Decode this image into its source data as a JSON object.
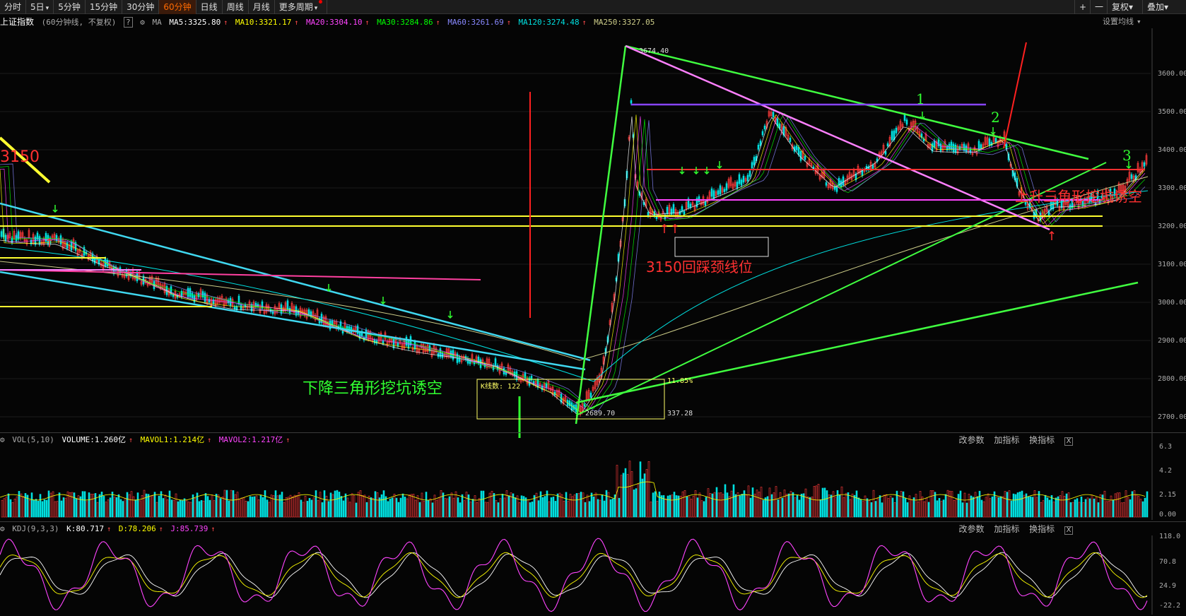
{
  "toolbar": {
    "tabs": [
      "分时",
      "5日",
      "5分钟",
      "15分钟",
      "30分钟",
      "60分钟",
      "日线",
      "周线",
      "月线",
      "更多周期"
    ],
    "active": "60分钟",
    "right": {
      "plus": "+",
      "minus": "一",
      "fuquan": "复权",
      "diejia": "叠加"
    }
  },
  "main_legend": {
    "title": "上证指数",
    "subtitle": "(60分钟线, 不复权)",
    "help": "?",
    "ma_label": "MA",
    "ma5": "MA5:3325.80",
    "ma10": "MA10:3321.17",
    "ma20": "MA20:3304.10",
    "ma30": "MA30:3284.86",
    "ma60": "MA60:3261.69",
    "ma120": "MA120:3274.48",
    "ma250": "MA250:3327.05",
    "settings": "设置均线"
  },
  "price_axis": [
    "3600.00",
    "3500.00",
    "3400.00",
    "3300.00",
    "3200.00",
    "3100.00",
    "3000.00",
    "2900.00",
    "2800.00",
    "2700.00"
  ],
  "annotations": {
    "left_3150": "3150",
    "desc_triangle": "下降三角形挖坑诱空",
    "asc_triangle": "上升三角形挖坑诱空",
    "neckline": "3150回踩颈线位",
    "high_label": "3674.40",
    "low_label": "2689.70",
    "kline_count": "K线数: 122",
    "pct": "11.85%",
    "span": "337.28",
    "num1": "1",
    "num2": "2",
    "num3": "3"
  },
  "vol_legend": {
    "name": "VOL(5,10)",
    "volume": "VOLUME:1.260亿",
    "mavol1": "MAVOL1:1.214亿",
    "mavol2": "MAVOL2:1.217亿"
  },
  "vol_axis": [
    "6.3",
    "4.2",
    "2.15",
    "0.00"
  ],
  "kdj_legend": {
    "name": "KDJ(9,3,3)",
    "k": "K:80.717",
    "d": "D:78.206",
    "j": "J:85.739"
  },
  "kdj_axis": [
    "118.0",
    "70.8",
    "24.9",
    "-22.2"
  ],
  "panel_buttons": {
    "params": "改参数",
    "add": "加指标",
    "switch": "换指标",
    "close": "X"
  },
  "colors": {
    "up": "#ff3b3b",
    "down": "#00e0e0",
    "ma5": "#ffffff",
    "ma10": "#ffff00",
    "ma20": "#ff44ff",
    "ma30": "#00ff00",
    "ma60": "#8888ff",
    "ma120": "#00e0e0",
    "ma250": "#cccc88"
  }
}
